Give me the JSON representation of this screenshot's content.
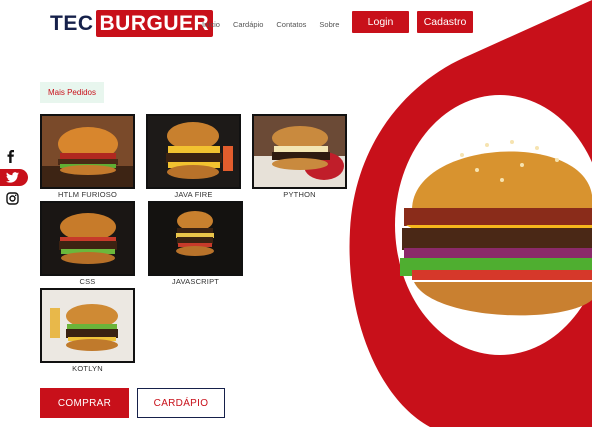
{
  "header": {
    "logo_part1": "TEC",
    "logo_part2": "BURGUER",
    "nav": [
      "Início",
      "Cardápio",
      "Contatos",
      "Sobre"
    ],
    "login_label": "Login",
    "signup_label": "Cadastro"
  },
  "social": [
    "facebook-icon",
    "twitter-icon",
    "instagram-icon"
  ],
  "section": {
    "badge": "Mais Pedidos"
  },
  "products": [
    {
      "name": "HTLM FURIOSO"
    },
    {
      "name": "JAVA FIRE"
    },
    {
      "name": "PYTHON"
    },
    {
      "name": "CSS"
    },
    {
      "name": "JAVASCRIPT"
    },
    {
      "name": "KOTLYN"
    }
  ],
  "actions": {
    "buy_label": "COMPRAR",
    "menu_label": "CARDÁPIO"
  },
  "colors": {
    "brand_red": "#c8101a",
    "navy": "#16204a",
    "badge_bg": "#e8f6ee"
  }
}
